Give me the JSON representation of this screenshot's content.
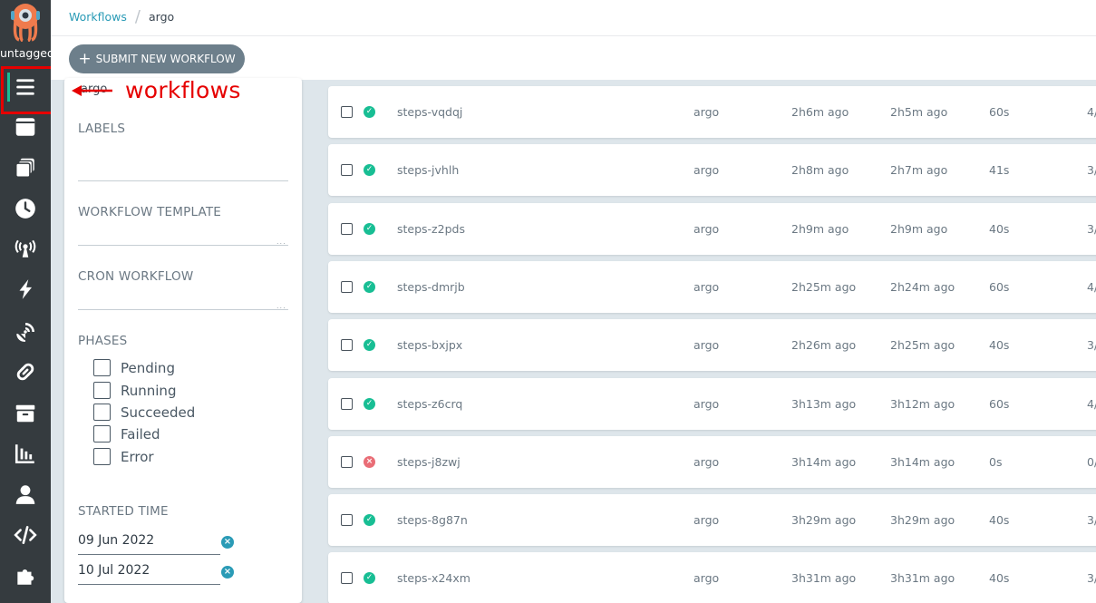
{
  "sidebar": {
    "logo_label": "untagged",
    "items": [
      {
        "icon": "workflows-icon"
      },
      {
        "icon": "workflow-templates-icon"
      },
      {
        "icon": "cluster-workflow-templates-icon"
      },
      {
        "icon": "cron-workflows-icon"
      },
      {
        "icon": "event-sources-icon"
      },
      {
        "icon": "sensors-icon"
      },
      {
        "icon": "event-flow-icon"
      },
      {
        "icon": "workflow-eventbindings-icon"
      },
      {
        "icon": "archived-workflows-icon"
      },
      {
        "icon": "reports-icon"
      },
      {
        "icon": "user-icon"
      },
      {
        "icon": "api-docs-icon"
      },
      {
        "icon": "plugins-icon"
      }
    ]
  },
  "breadcrumb": {
    "root": "Workflows",
    "separator": "/",
    "namespace": "argo"
  },
  "toolbar": {
    "submit_label": "SUBMIT NEW WORKFLOW"
  },
  "annotation": {
    "text": "workflows",
    "color": "#e60000"
  },
  "filters": {
    "namespace": "argo",
    "labels_title": "LABELS",
    "workflow_template_title": "WORKFLOW TEMPLATE",
    "cron_workflow_title": "CRON WORKFLOW",
    "phases_title": "PHASES",
    "phases": [
      "Pending",
      "Running",
      "Succeeded",
      "Failed",
      "Error"
    ],
    "started_time_title": "STARTED TIME",
    "date_from": "09 Jun 2022",
    "date_to": "10 Jul 2022"
  },
  "rows": [
    {
      "name": "steps-vqdqj",
      "namespace": "argo",
      "started": "2h6m ago",
      "finished": "2h5m ago",
      "duration": "60s",
      "progress": "4/",
      "status": "succeeded"
    },
    {
      "name": "steps-jvhlh",
      "namespace": "argo",
      "started": "2h8m ago",
      "finished": "2h7m ago",
      "duration": "41s",
      "progress": "3/",
      "status": "succeeded"
    },
    {
      "name": "steps-z2pds",
      "namespace": "argo",
      "started": "2h9m ago",
      "finished": "2h9m ago",
      "duration": "40s",
      "progress": "3/",
      "status": "succeeded"
    },
    {
      "name": "steps-dmrjb",
      "namespace": "argo",
      "started": "2h25m ago",
      "finished": "2h24m ago",
      "duration": "60s",
      "progress": "4/",
      "status": "succeeded"
    },
    {
      "name": "steps-bxjpx",
      "namespace": "argo",
      "started": "2h26m ago",
      "finished": "2h25m ago",
      "duration": "40s",
      "progress": "3/",
      "status": "succeeded"
    },
    {
      "name": "steps-z6crq",
      "namespace": "argo",
      "started": "3h13m ago",
      "finished": "3h12m ago",
      "duration": "60s",
      "progress": "4/",
      "status": "succeeded"
    },
    {
      "name": "steps-j8zwj",
      "namespace": "argo",
      "started": "3h14m ago",
      "finished": "3h14m ago",
      "duration": "0s",
      "progress": "0/",
      "status": "error"
    },
    {
      "name": "steps-8g87n",
      "namespace": "argo",
      "started": "3h29m ago",
      "finished": "3h29m ago",
      "duration": "40s",
      "progress": "3/",
      "status": "succeeded"
    },
    {
      "name": "steps-x24xm",
      "namespace": "argo",
      "started": "3h31m ago",
      "finished": "3h31m ago",
      "duration": "40s",
      "progress": "3/",
      "status": "succeeded"
    }
  ]
}
